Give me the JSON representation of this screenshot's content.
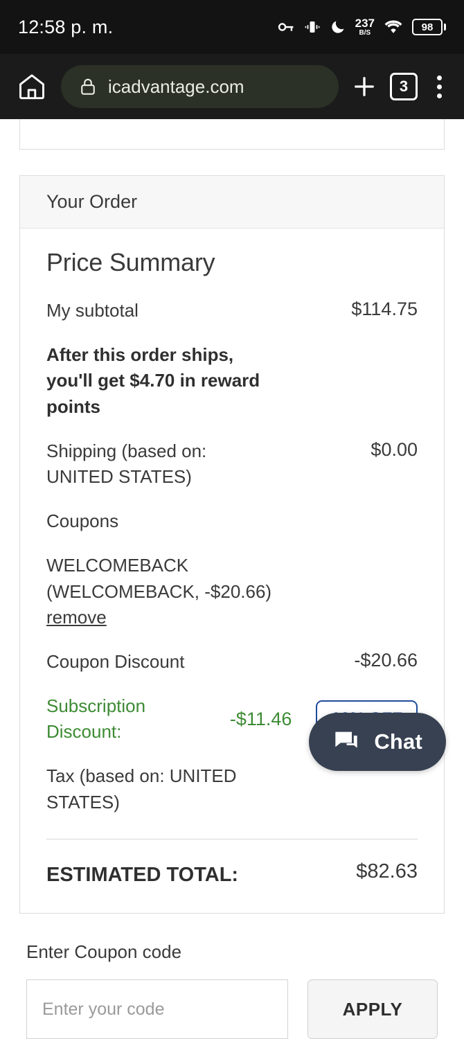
{
  "status_bar": {
    "time": "12:58 p. m.",
    "icons": [
      "vpn-key-icon",
      "vibrate-icon",
      "do-not-disturb-icon",
      "wifi-icon"
    ],
    "network_speed": "237",
    "network_speed_unit": "B/S",
    "battery_percent": "98"
  },
  "browser": {
    "url": "icadvantage.com",
    "tab_count": "3"
  },
  "order_card": {
    "header": "Your Order",
    "summary_title": "Price Summary",
    "subtotal": {
      "label": "My subtotal",
      "value": "$114.75"
    },
    "reward_note": "After this order ships, you'll get $4.70 in reward points",
    "shipping": {
      "label": "Shipping (based on: UNITED STATES)",
      "value": "$0.00"
    },
    "coupons_label": "Coupons",
    "applied_coupon": "WELCOMEBACK (WELCOMEBACK, -$20.66)",
    "remove_label": "remove",
    "coupon_discount": {
      "label": "Coupon Discount",
      "value": "-$20.66"
    },
    "subscription_discount": {
      "label": "Subscription Discount:",
      "value": "-$11.46",
      "badge": "10% OFF",
      "text_color": "#3d8b35",
      "badge_color": "#1e4b9c"
    },
    "tax": {
      "label": "Tax (based on: UNITED STATES)",
      "value": ""
    },
    "estimated_total": {
      "label": "ESTIMATED TOTAL:",
      "value": "$82.63"
    }
  },
  "coupon_entry": {
    "heading": "Enter Coupon code",
    "placeholder": "Enter your code",
    "apply_label": "APPLY"
  },
  "chat_widget": {
    "label": "Chat",
    "background": "#374151"
  }
}
